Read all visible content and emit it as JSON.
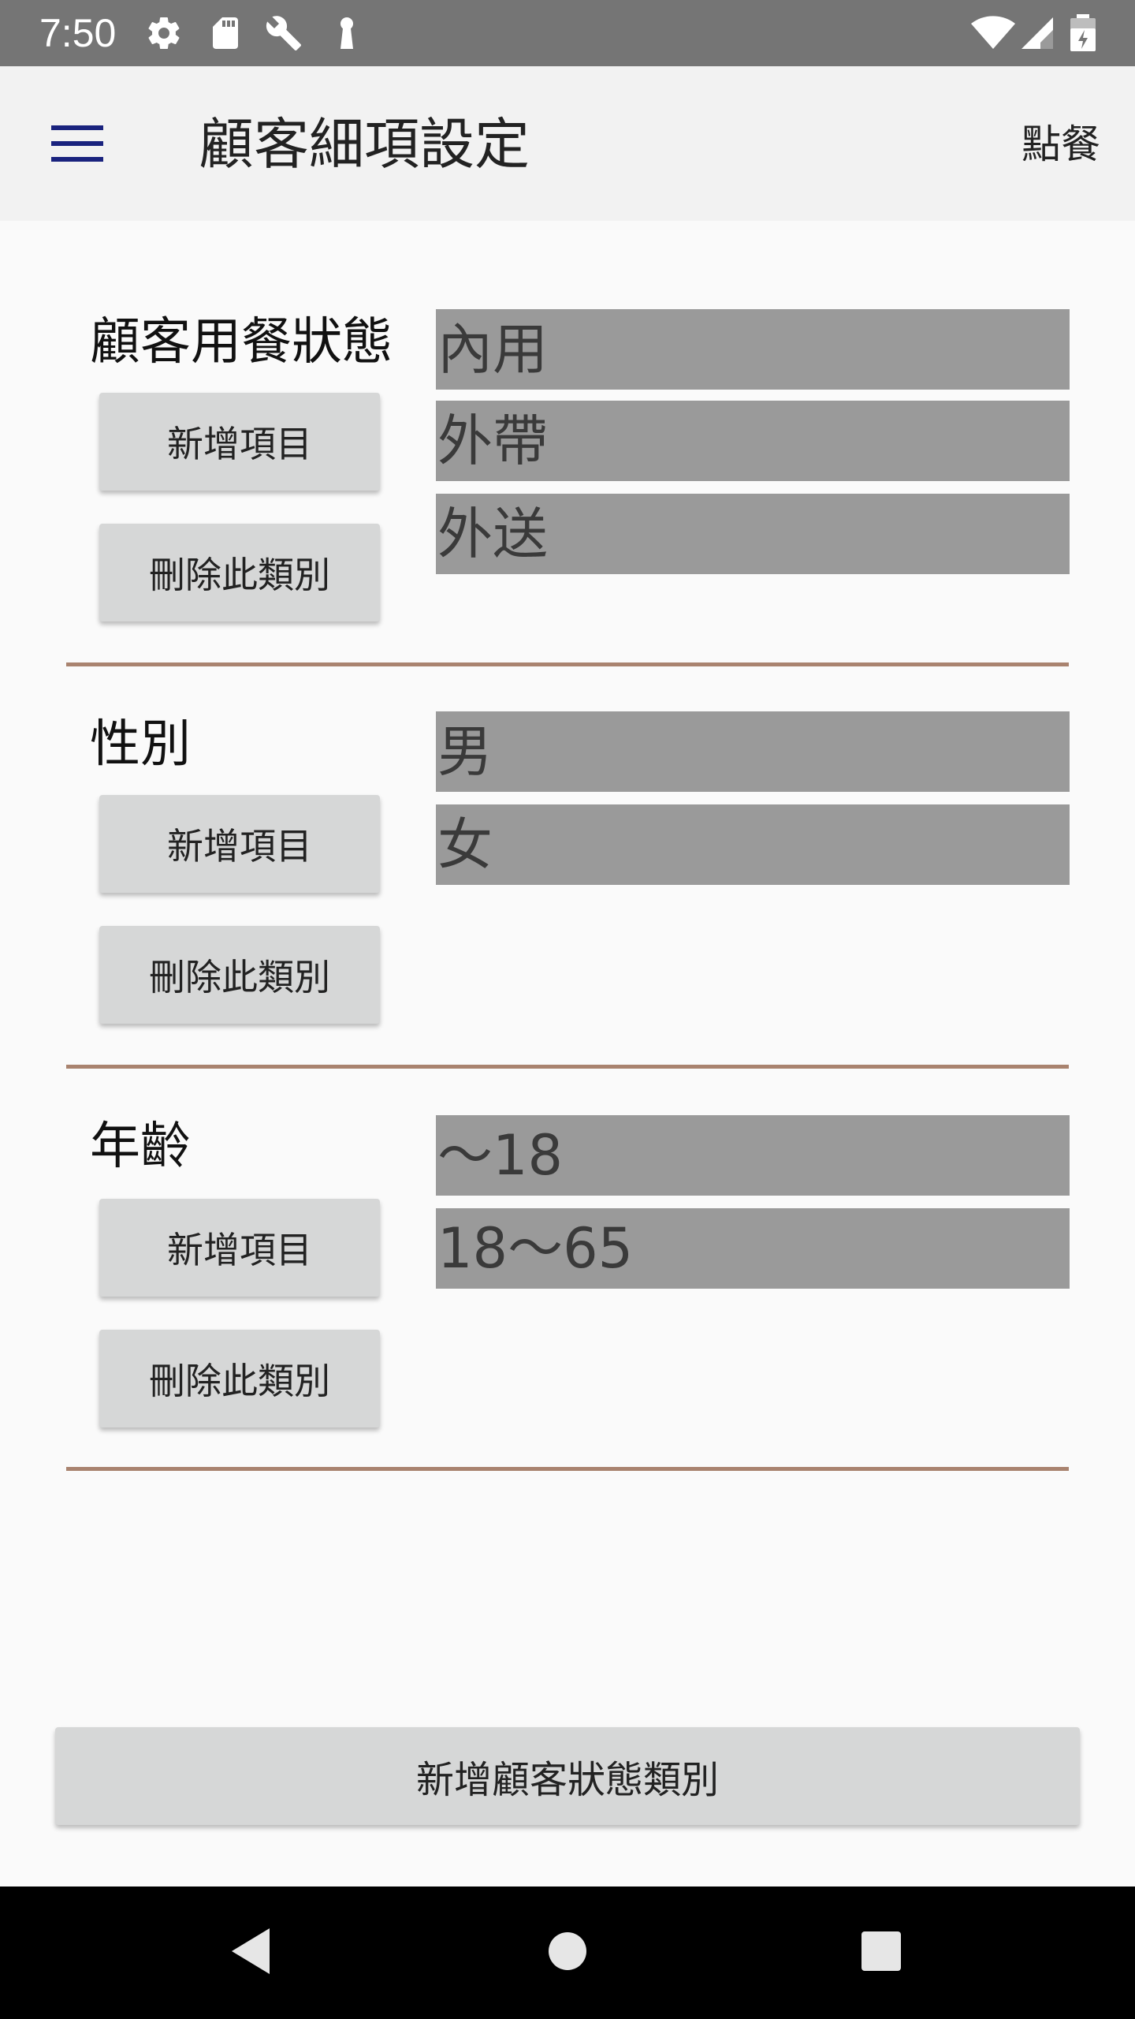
{
  "status_bar": {
    "time": "7:50",
    "icons": [
      "settings-icon",
      "sd-card-icon",
      "wrench-icon",
      "keyhole-icon",
      "wifi-icon",
      "cell-signal-icon",
      "battery-icon"
    ]
  },
  "app_bar": {
    "title": "顧客細項設定",
    "action_label": "點餐",
    "menu_icon": "hamburger-menu-icon",
    "menu_color": "#1a237e"
  },
  "categories": [
    {
      "title": "顧客用餐狀態",
      "add_label": "新增項目",
      "delete_label": "刪除此類別",
      "items": [
        "內用",
        "外帶",
        "外送"
      ]
    },
    {
      "title": "性別",
      "add_label": "新增項目",
      "delete_label": "刪除此類別",
      "items": [
        "男",
        "女"
      ]
    },
    {
      "title": "年齡",
      "add_label": "新增項目",
      "delete_label": "刪除此類別",
      "items": [
        "～18",
        "18～65"
      ]
    }
  ],
  "add_category_label": "新增顧客狀態類別",
  "colors": {
    "item_background": "#9a9a9a",
    "divider": "#a9836f",
    "button_background": "#d6d7d7"
  },
  "nav_bar": {
    "icons": [
      "back-icon",
      "home-icon",
      "recents-icon"
    ]
  }
}
